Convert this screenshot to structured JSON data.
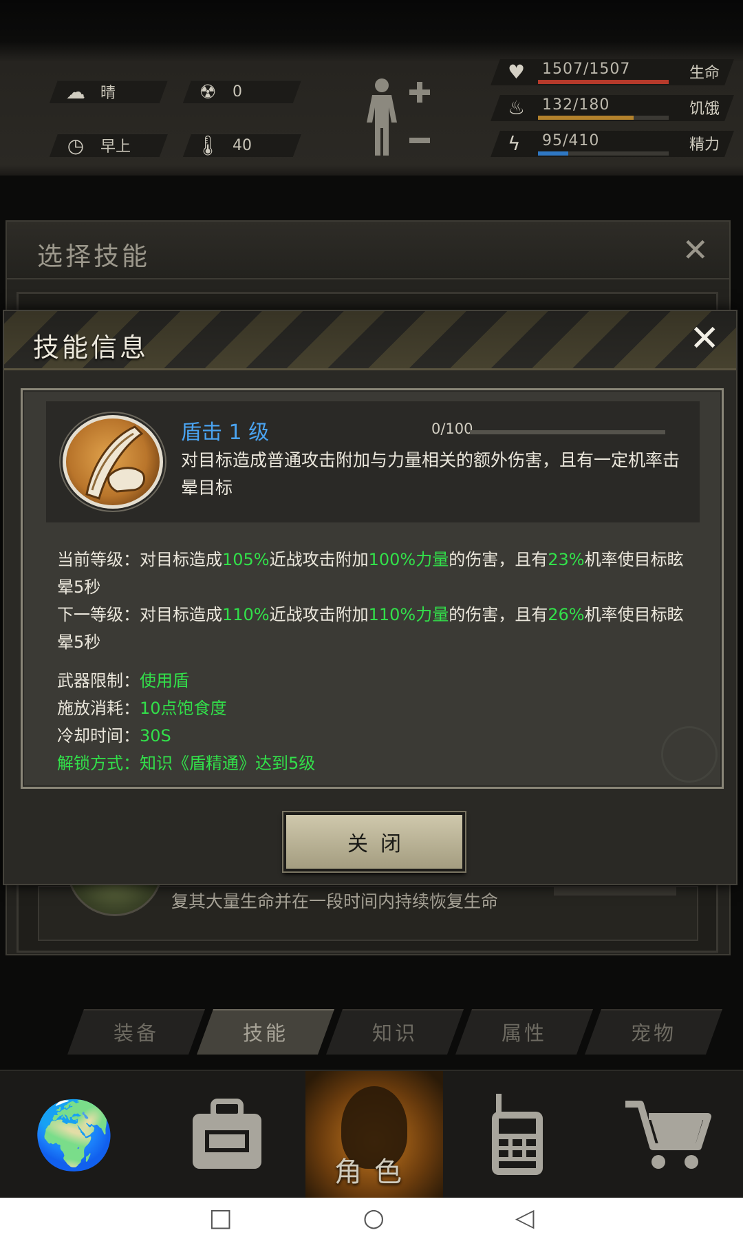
{
  "hud": {
    "weather": {
      "icon": "cloud-sun-icon",
      "label": "晴"
    },
    "radiation": {
      "icon": "radiation-icon",
      "value": "0"
    },
    "time_of_day": {
      "icon": "clock-icon",
      "label": "早上"
    },
    "temperature": {
      "icon": "thermometer-icon",
      "value": "40"
    },
    "stats": [
      {
        "icon": "heart-icon",
        "text": "1507/1507",
        "label": "生命",
        "fraction": 1.0,
        "color": "#b63a2b"
      },
      {
        "icon": "stomach-icon",
        "text": "132/180",
        "label": "饥饿",
        "fraction": 0.733,
        "color": "#b3822c"
      },
      {
        "icon": "energy-icon",
        "text": "95/410",
        "label": "精力",
        "fraction": 0.232,
        "color": "#2f78c4"
      }
    ]
  },
  "back_dialog": {
    "title": "选择技能",
    "item_text": "复其大量生命并在一段时间内持续恢复生命"
  },
  "skill_dialog": {
    "title": "技能信息",
    "skill": {
      "name": "盾击 1 级",
      "progress_text": "0/100",
      "progress": 0.0,
      "description": "对目标造成普通攻击附加与力量相关的额外伤害，且有一定机率击晕目标"
    },
    "current_level": {
      "prefix": "当前等级：对目标造成",
      "dmg": "105%",
      "mid": "近战攻击附加",
      "str": "100%力量",
      "mid2": "的伤害，且有",
      "chance": "23%",
      "suffix": "机率使目标眩晕5秒"
    },
    "next_level": {
      "prefix": "下一等级：对目标造成",
      "dmg": "110%",
      "mid": "近战攻击附加",
      "str": "110%力量",
      "mid2": "的伤害，且有",
      "chance": "26%",
      "suffix": "机率使目标眩晕5秒"
    },
    "weapon_limit": {
      "label": "武器限制：",
      "value": "使用盾"
    },
    "cost": {
      "label": "施放消耗：",
      "value": "10点饱食度"
    },
    "cooldown": {
      "label": "冷却时间：",
      "value": "30S"
    },
    "unlock": {
      "label": "解锁方式：",
      "value": "知识《盾精通》达到5级"
    },
    "close_button": "关闭"
  },
  "tabs": [
    {
      "label": "装备",
      "active": false
    },
    {
      "label": "技能",
      "active": true
    },
    {
      "label": "知识",
      "active": false
    },
    {
      "label": "属性",
      "active": false
    },
    {
      "label": "宠物",
      "active": false
    }
  ],
  "bottom_nav": {
    "items": [
      {
        "icon": "globe-icon"
      },
      {
        "icon": "backpack-icon"
      },
      {
        "icon": "character-icon",
        "label": "角色",
        "active": true
      },
      {
        "icon": "radio-icon"
      },
      {
        "icon": "cart-icon"
      }
    ]
  },
  "system_bar": {
    "buttons": [
      "recent-apps-icon",
      "home-icon",
      "back-icon"
    ]
  }
}
